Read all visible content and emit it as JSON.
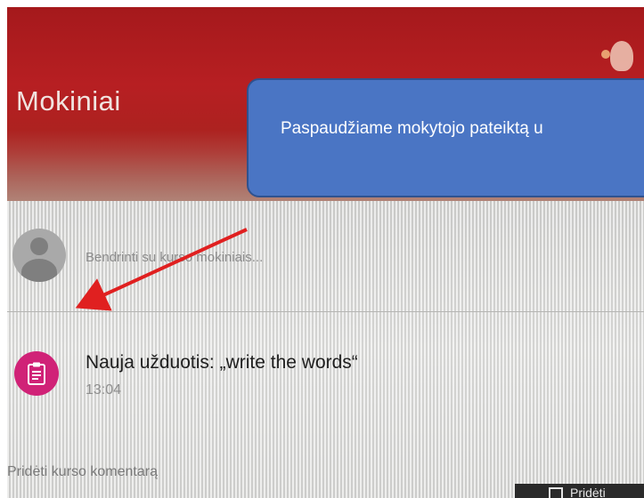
{
  "photo": {
    "class_title": "Mokiniai",
    "share_placeholder": "Bendrinti su kurso mokiniais...",
    "assignment": {
      "title": "Nauja užduotis: „write the words“",
      "date": "13:04"
    },
    "add_comment": "Pridėti kurso komentarą",
    "corner_label": "Pridėti"
  },
  "callout": {
    "text": "Paspaudžiame mokytojo pateiktą u"
  },
  "colors": {
    "banner": "#b71f22",
    "assignment_icon": "#d02277",
    "callout_fill": "#4a75c4",
    "arrow": "#e02020"
  }
}
